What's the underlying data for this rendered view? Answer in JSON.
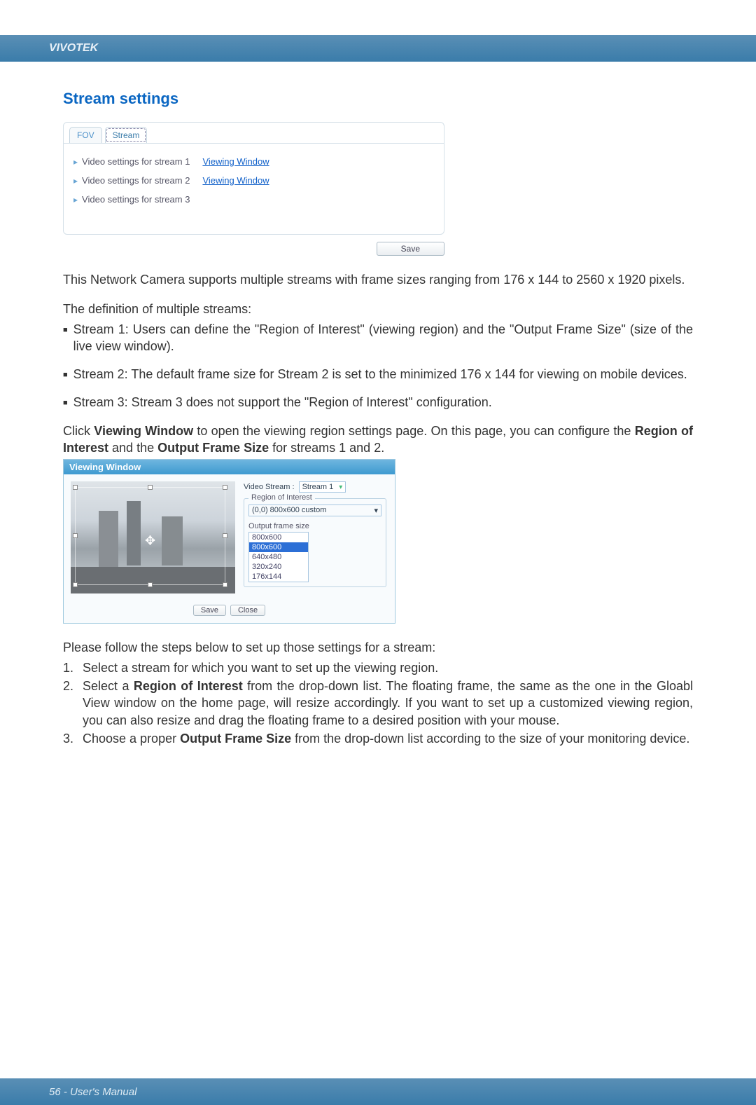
{
  "header": {
    "brand": "VIVOTEK"
  },
  "section_title": "Stream settings",
  "tabs": {
    "fov": "FOV",
    "stream": "Stream"
  },
  "panel": {
    "rows": [
      {
        "label": "Video settings for stream 1",
        "link": "Viewing Window"
      },
      {
        "label": "Video settings for stream 2",
        "link": "Viewing Window"
      },
      {
        "label": "Video settings for stream 3",
        "link": ""
      }
    ],
    "save": "Save"
  },
  "para_intro": "This Network Camera supports multiple streams with frame sizes ranging from 176 x 144 to 2560 x 1920 pixels.",
  "para_def": "The definition of multiple streams:",
  "bul1": "Stream 1: Users can define the \"Region of Interest\" (viewing region) and the \"Output Frame Size\" (size of the live view window).",
  "bul2": "Stream 2: The default frame size for Stream 2 is set to the minimized 176 x 144 for viewing on mobile devices.",
  "bul3": "Stream 3: Stream 3 does not support the \"Region of Interest\" configuration.",
  "para_click_pre": "Click ",
  "para_click_b1": "Viewing Window",
  "para_click_mid": " to open the viewing region settings page. On this page, you can configure the ",
  "para_click_b2": "Region of Interest",
  "para_click_mid2": " and the ",
  "para_click_b3": "Output Frame Size",
  "para_click_post": " for streams 1 and 2.",
  "vw": {
    "title": "Viewing Window",
    "video_stream_label": "Video Stream :",
    "video_stream_value": "Stream 1",
    "roi_legend": "Region of Interest",
    "roi_value": "(0,0) 800x600 custom",
    "ofs_label": "Output frame size",
    "ofs_selected": "800x600",
    "ofs_options": [
      "800x600",
      "640x480",
      "320x240",
      "176x144"
    ],
    "save": "Save",
    "close": "Close"
  },
  "para_steps": "Please follow the steps below to set up those settings for a stream:",
  "step1": "Select a stream for which you want to set up the viewing region.",
  "step2_pre": "Select a ",
  "step2_b": "Region of Interest",
  "step2_post": " from the drop-down list. The floating frame, the same as the one in the Gloabl View window on the home page, will resize accordingly. If you want to set up a customized viewing region, you can also resize and drag the floating frame to a desired position with your mouse.",
  "step3_pre": "Choose a proper ",
  "step3_b": "Output Frame Size",
  "step3_post": " from the drop-down list according to the size of your monitoring device.",
  "footer": {
    "text": "56 - User's Manual"
  }
}
